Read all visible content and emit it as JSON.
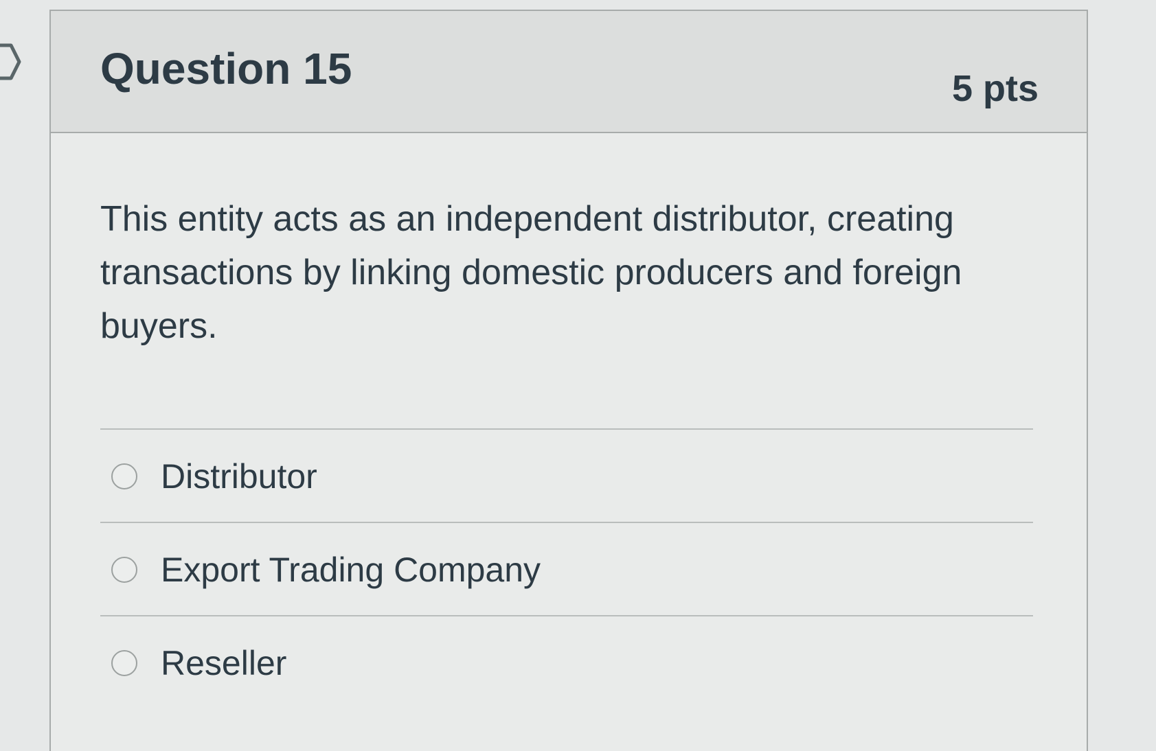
{
  "question": {
    "title": "Question 15",
    "points": "5 pts",
    "text": "This entity acts as an independent distributor, creating transactions by linking domestic producers and foreign buyers.",
    "answers": [
      {
        "label": "Distributor",
        "selected": false
      },
      {
        "label": "Export Trading Company",
        "selected": false
      },
      {
        "label": "Reseller",
        "selected": false
      }
    ]
  },
  "icons": {
    "nav": "chevron-right-icon",
    "option": "radio-button"
  },
  "colors": {
    "text": "#2d3b45",
    "header_background": "#dcdedd",
    "card_background": "#e9ebea",
    "border": "#a7abaa"
  }
}
